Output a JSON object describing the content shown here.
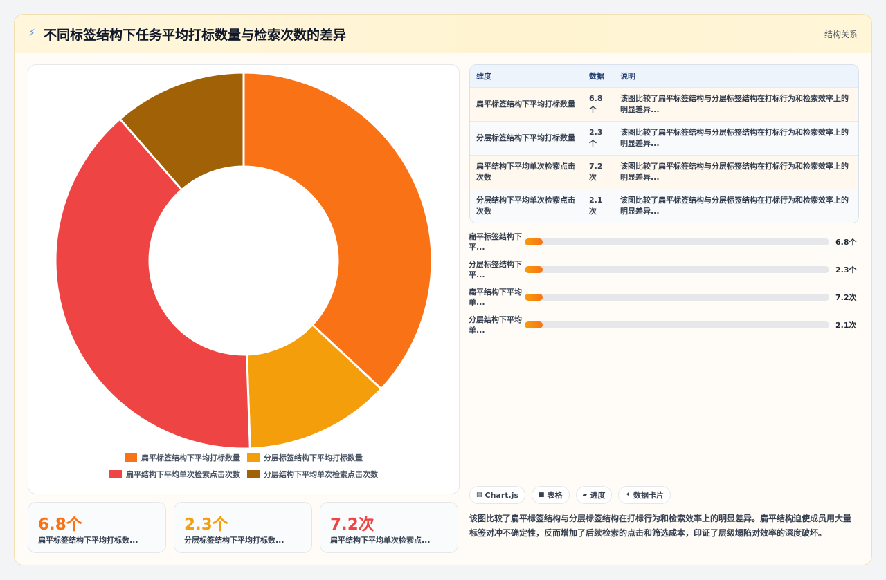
{
  "header": {
    "title": "不同标签结构下任务平均打标数量与检索次数的差异",
    "tag": "结构关系"
  },
  "chart_data": {
    "type": "pie",
    "variant": "doughnut",
    "categories": [
      "扁平标签结构下平均打标数量",
      "分层标签结构下平均打标数量",
      "扁平结构下平均单次检索点击次数",
      "分层结构下平均单次检索点击次数"
    ],
    "values": [
      6.8,
      2.3,
      7.2,
      2.1
    ],
    "colors": [
      "#f97316",
      "#f59e0b",
      "#ef4444",
      "#a16207"
    ],
    "legend_position": "bottom"
  },
  "kpis": [
    {
      "value": "6.8个",
      "label": "扁平标签结构下平均打标数...",
      "color": "#f97316"
    },
    {
      "value": "2.3个",
      "label": "分层标签结构下平均打标数...",
      "color": "#f59e0b"
    },
    {
      "value": "7.2次",
      "label": "扁平结构下平均单次检索点...",
      "color": "#ef4444"
    }
  ],
  "table": {
    "headers": [
      "维度",
      "数据",
      "说明"
    ],
    "rows": [
      [
        "扁平标签结构下平均打标数量",
        "6.8个",
        "该图比较了扁平标签结构与分层标签结构在打标行为和检索效率上的明显差异..."
      ],
      [
        "分层标签结构下平均打标数量",
        "2.3个",
        "该图比较了扁平标签结构与分层标签结构在打标行为和检索效率上的明显差异..."
      ],
      [
        "扁平结构下平均单次检索点击次数",
        "7.2次",
        "该图比较了扁平标签结构与分层标签结构在打标行为和检索效率上的明显差异..."
      ],
      [
        "分层结构下平均单次检索点击次数",
        "2.1次",
        "该图比较了扁平标签结构与分层标签结构在打标行为和检索效率上的明显差异..."
      ]
    ]
  },
  "bars": [
    {
      "label": "扁平标签结构下平...",
      "value": "6.8个",
      "fill": 0.06
    },
    {
      "label": "分层标签结构下平...",
      "value": "2.3个",
      "fill": 0.06
    },
    {
      "label": "扁平结构下平均单...",
      "value": "7.2次",
      "fill": 0.06
    },
    {
      "label": "分层结构下平均单...",
      "value": "2.1次",
      "fill": 0.06
    }
  ],
  "chips": [
    {
      "icon": "chart-icon",
      "label": "Chart.js"
    },
    {
      "icon": "table-icon",
      "label": "表格"
    },
    {
      "icon": "progress-icon",
      "label": "进度"
    },
    {
      "icon": "card-icon",
      "label": "数据卡片"
    }
  ],
  "summary": "该图比较了扁平标签结构与分层标签结构在打标行为和检索效率上的明显差异。扁平结构迫使成员用大量标签对冲不确定性，反而增加了后续检索的点击和筛选成本，印证了层级塌陷对效率的深度破坏。"
}
